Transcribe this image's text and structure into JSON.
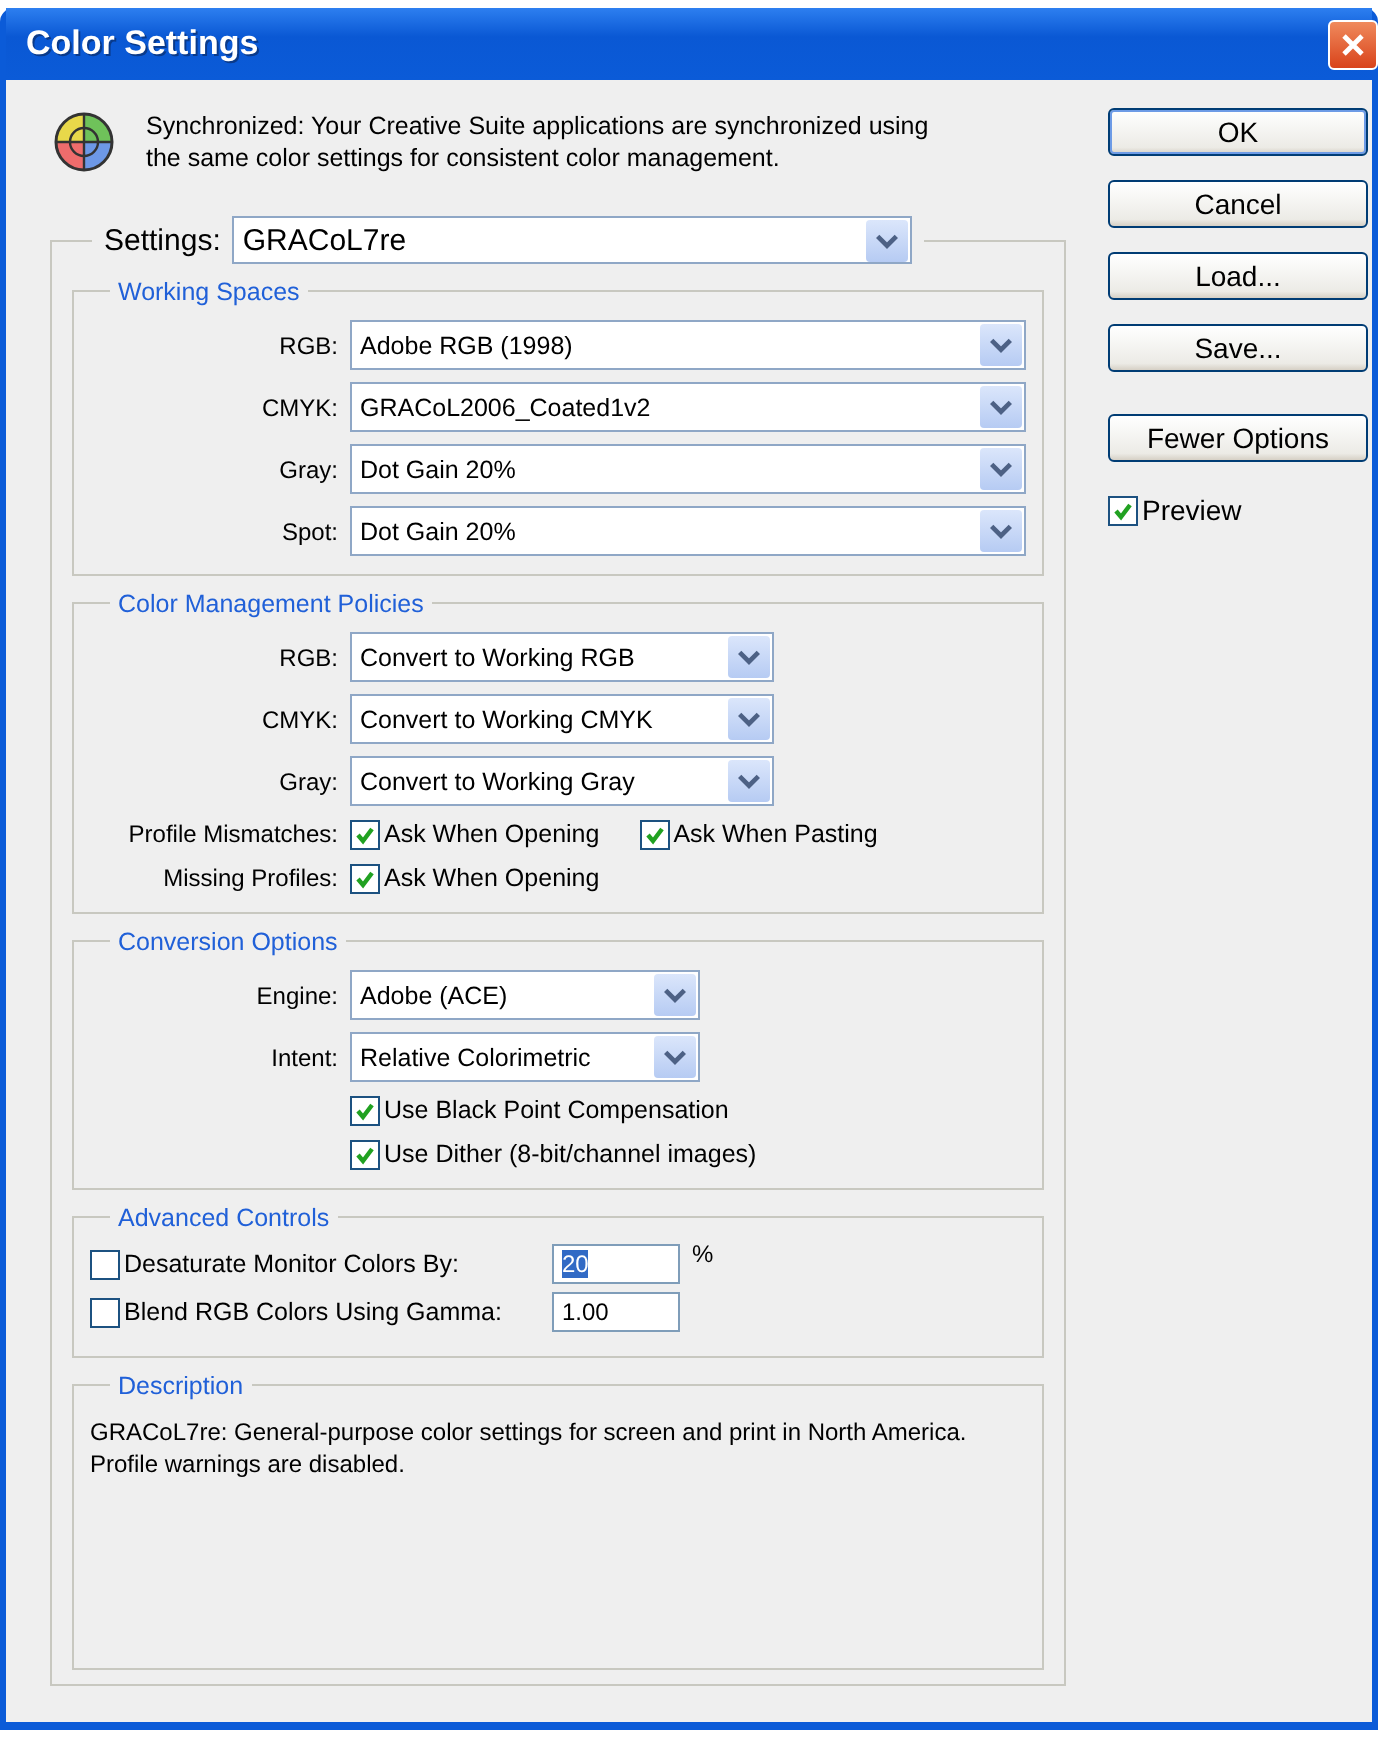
{
  "window": {
    "title": "Color Settings"
  },
  "sync_message": "Synchronized: Your Creative Suite applications are synchronized using the same color settings for consistent color management.",
  "settings": {
    "label": "Settings:",
    "value": "GRACoL7re"
  },
  "sections": [
    {
      "kind": "working_spaces",
      "title": "Working Spaces",
      "items": [
        {
          "kind": "select",
          "label": "RGB:",
          "value": "Adobe RGB (1998)"
        },
        {
          "kind": "select",
          "label": "CMYK:",
          "value": "GRACoL2006_Coated1v2"
        },
        {
          "kind": "select",
          "label": "Gray:",
          "value": "Dot Gain 20%"
        },
        {
          "kind": "select",
          "label": "Spot:",
          "value": "Dot Gain 20%"
        }
      ]
    },
    {
      "kind": "policies",
      "title": "Color Management Policies",
      "items": [
        {
          "kind": "select",
          "label": "RGB:",
          "value": "Convert to Working RGB"
        },
        {
          "kind": "select",
          "label": "CMYK:",
          "value": "Convert to Working CMYK"
        },
        {
          "kind": "select",
          "label": "Gray:",
          "value": "Convert to Working Gray"
        },
        {
          "kind": "checks",
          "label": "Profile Mismatches:",
          "options": [
            {
              "label": "Ask When Opening",
              "checked": true
            },
            {
              "label": "Ask When Pasting",
              "checked": true
            }
          ]
        },
        {
          "kind": "checks",
          "label": "Missing Profiles:",
          "options": [
            {
              "label": "Ask When Opening",
              "checked": true
            }
          ]
        }
      ]
    },
    {
      "kind": "conversion",
      "title": "Conversion Options",
      "items": [
        {
          "kind": "select",
          "label": "Engine:",
          "value": "Adobe (ACE)"
        },
        {
          "kind": "select",
          "label": "Intent:",
          "value": "Relative Colorimetric"
        },
        {
          "kind": "checks",
          "options": [
            {
              "label": "Use Black Point Compensation",
              "checked": true
            }
          ]
        },
        {
          "kind": "checks",
          "options": [
            {
              "label": "Use Dither (8-bit/channel images)",
              "checked": true
            }
          ]
        }
      ]
    },
    {
      "kind": "advanced",
      "title": "Advanced Controls",
      "items": [
        {
          "kind": "number",
          "label": "Desaturate Monitor Colors By:",
          "checked": false,
          "value": "20",
          "highlighted": true,
          "unit": "%"
        },
        {
          "kind": "number",
          "label": "Blend RGB Colors Using Gamma:",
          "checked": false,
          "value": "1.00",
          "highlighted": false
        }
      ]
    },
    {
      "kind": "description",
      "title": "Description",
      "items": [
        {
          "kind": "text",
          "text": "GRACoL7re:  General-purpose color settings for screen and print in North America. Profile warnings are disabled."
        }
      ]
    }
  ],
  "buttons": [
    {
      "label": "OK",
      "default": true
    },
    {
      "label": "Cancel",
      "default": false
    },
    {
      "label": "Load...",
      "default": false
    },
    {
      "label": "Save...",
      "default": false
    }
  ],
  "options_button": {
    "label": "Fewer Options"
  },
  "preview": {
    "label": "Preview",
    "checked": true
  }
}
